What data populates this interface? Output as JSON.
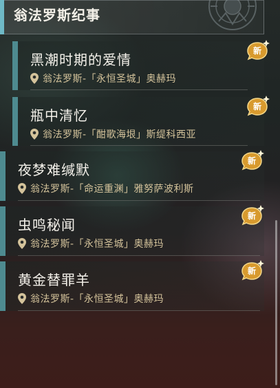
{
  "header": {
    "title": "翁法罗斯纪事"
  },
  "badge_label": "新",
  "items": [
    {
      "title": "黑潮时期的爱情",
      "location": "翁法罗斯-「永恒圣城」奥赫玛"
    },
    {
      "title": "瓶中清忆",
      "location": "翁法罗斯-「酣歌海垠」斯缇科西亚"
    },
    {
      "title": "夜梦难缄默",
      "location": "翁法罗斯-「命运重渊」雅努萨波利斯"
    },
    {
      "title": "虫鸣秘闻",
      "location": "翁法罗斯-「永恒圣城」奥赫玛"
    },
    {
      "title": "黄金替罪羊",
      "location": "翁法罗斯-「永恒圣城」奥赫玛"
    }
  ],
  "colors": {
    "accent": "#6fb9c6",
    "bar": "#4e8b90",
    "location": "#d4c39b",
    "badge": "#d89a2e"
  },
  "icons": {
    "location": "location-pin-icon",
    "emblem": "emblem-icon"
  }
}
